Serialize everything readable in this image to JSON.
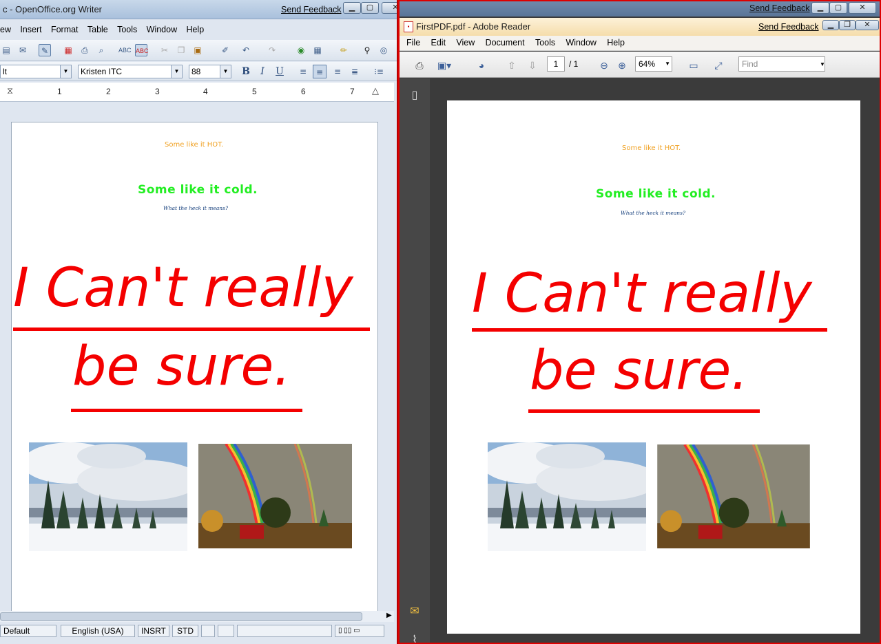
{
  "writer": {
    "title": "c - OpenOffice.org Writer",
    "send_feedback": "Send Feedback",
    "menu": [
      "ew",
      "Insert",
      "Format",
      "Table",
      "Tools",
      "Window",
      "Help"
    ],
    "style_value": "lt",
    "font_value": "Kristen ITC",
    "size_value": "88",
    "bold_label": "B",
    "italic_label": "I",
    "underline_label": "U",
    "ruler_numbers": [
      "1",
      "2",
      "3",
      "4",
      "5",
      "6",
      "7"
    ],
    "status": {
      "page_style": "Default",
      "language": "English (USA)",
      "insert_mode": "INSRT",
      "selection_mode": "STD"
    }
  },
  "reader": {
    "title": "FirstPDF.pdf - Adobe Reader",
    "send_feedback_outer": "Send Feedback",
    "send_feedback": "Send Feedback",
    "menu": [
      "File",
      "Edit",
      "View",
      "Document",
      "Tools",
      "Window",
      "Help"
    ],
    "page_current": "1",
    "page_total": "/ 1",
    "zoom": "64%",
    "find_placeholder": "Find"
  },
  "document": {
    "line1": "Some like it HOT.",
    "line2": "Some like it cold.",
    "line3": "What the heck it means?",
    "headline_1": "I Can't really",
    "headline_2": "be sure.",
    "photo1_alt": "Snowy landscape with trees",
    "photo2_alt": "Rainbow over farm"
  },
  "colors": {
    "hot": "#f0a020",
    "cold": "#22ee22",
    "heck": "#153f7c",
    "headline": "#f40000"
  },
  "icons": {
    "writer_toolbar": [
      "save-icon",
      "edit-icon",
      "edit-mode-icon",
      "pdf-icon",
      "print-icon",
      "preview-icon",
      "spellcheck-icon",
      "autospell-icon",
      "cut-icon",
      "copy-icon",
      "paste-icon",
      "format-paint-icon",
      "undo-icon",
      "redo-icon",
      "hyperlink-icon",
      "table-icon",
      "draw-icon",
      "find-icon",
      "navigator-icon"
    ],
    "reader_toolbar": [
      "print-icon",
      "collaborate-icon",
      "share-icon",
      "prev-page-icon",
      "next-page-icon",
      "zoom-out-icon",
      "zoom-in-icon",
      "fit-page-icon",
      "fit-width-icon"
    ]
  }
}
